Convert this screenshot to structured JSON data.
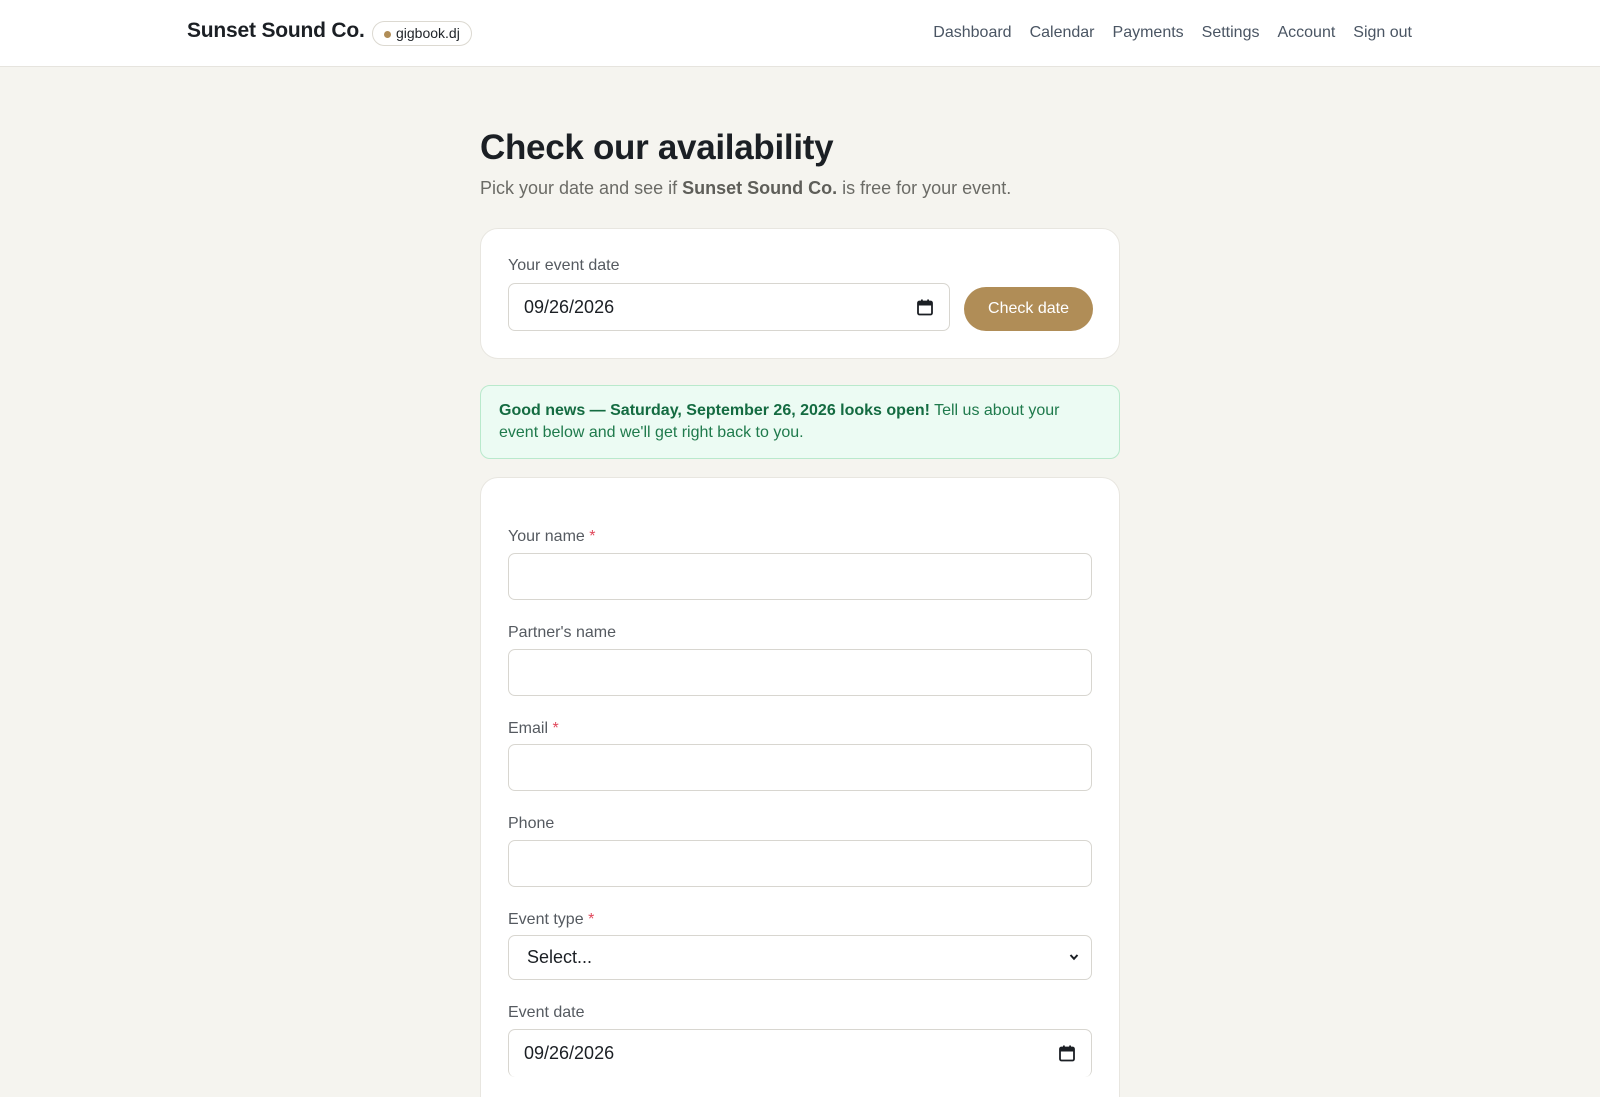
{
  "header": {
    "brand": "Sunset Sound Co.",
    "badge": "gigbook.dj",
    "nav": [
      "Dashboard",
      "Calendar",
      "Payments",
      "Settings",
      "Account",
      "Sign out"
    ]
  },
  "hero": {
    "title": "Check our availability",
    "subtitle_pre": "Pick your date and see if ",
    "subtitle_brand": "Sunset Sound Co.",
    "subtitle_post": " is free for your event."
  },
  "date_check": {
    "label": "Your event date",
    "value": "09/26/2026",
    "button": "Check date"
  },
  "alert": {
    "bold": "Good news — Saturday, September 26, 2026 looks open!",
    "rest": " Tell us about your event below and we'll get right back to you."
  },
  "form": {
    "required_mark": "*",
    "name_label": "Your name",
    "partner_label": "Partner's name",
    "email_label": "Email",
    "phone_label": "Phone",
    "event_type_label": "Event type",
    "event_type_value": "Select...",
    "event_date_label": "Event date",
    "event_date_value": "09/26/2026"
  },
  "colors": {
    "accent": "#b08d57",
    "success_bg": "#ecfbf3",
    "success_text": "#146b41",
    "required": "#e0475a"
  }
}
